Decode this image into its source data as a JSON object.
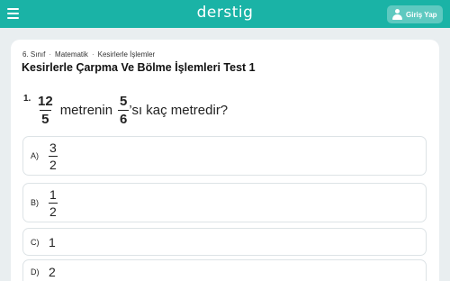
{
  "header": {
    "logo": "derstig",
    "login_label": "Giriş Yap"
  },
  "breadcrumb": [
    "6. Sınıf",
    "Matematik",
    "Kesirlerle İşlemler"
  ],
  "page_title": "Kesirlerle Çarpma Ve Bölme İşlemleri Test 1",
  "question": {
    "number": "1.",
    "frac1": {
      "num": "12",
      "den": "5"
    },
    "text1": "metrenin",
    "frac2": {
      "num": "5",
      "den": "6"
    },
    "text2": "’sı kaç metredir?"
  },
  "options": [
    {
      "letter": "A)",
      "num": "3",
      "den": "2"
    },
    {
      "letter": "B)",
      "num": "1",
      "den": "2"
    },
    {
      "letter": "C)",
      "value": "1"
    },
    {
      "letter": "D)",
      "value": "2"
    }
  ]
}
